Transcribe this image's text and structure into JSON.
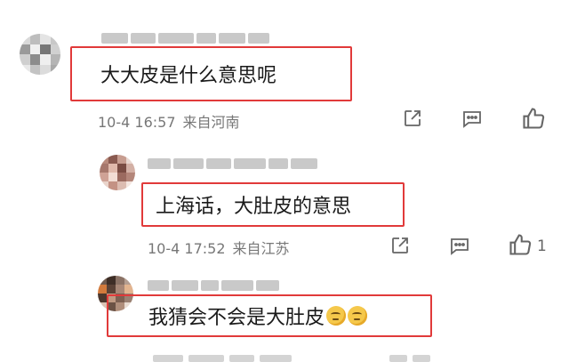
{
  "comments": [
    {
      "text": "大大皮是什么意思呢",
      "time": "10-4 16:57",
      "location": "来自河南",
      "like_count": ""
    },
    {
      "text": "上海话，大肚皮的意思",
      "time": "10-4 17:52",
      "location": "来自江苏",
      "like_count": "1"
    },
    {
      "text": "我猜会不会是大肚皮",
      "emoji_count": 2
    }
  ],
  "icons": {
    "share": "share-icon",
    "comment": "comment-icon",
    "like": "thumbs-up-icon",
    "emoji": "thinking-face-icon"
  },
  "colors": {
    "highlight_border": "#e13a3a",
    "meta_text": "#777777",
    "icon_stroke": "#666666"
  }
}
